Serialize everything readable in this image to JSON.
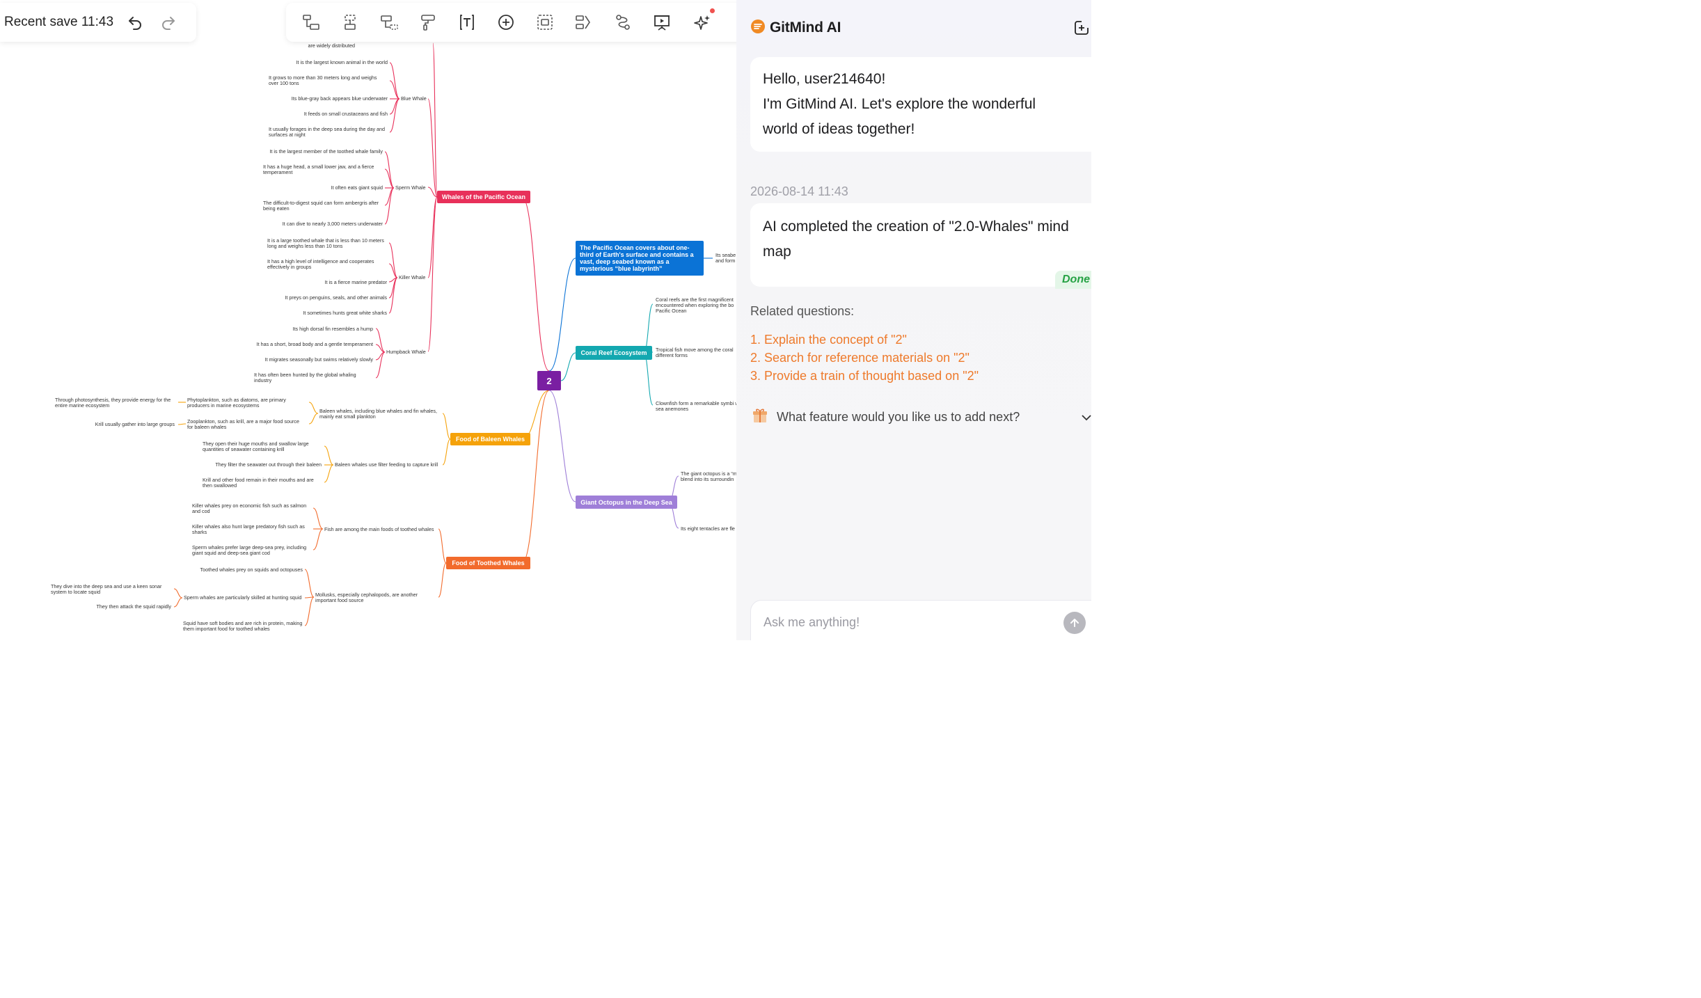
{
  "header": {
    "recent_save": "Recent save 11:43",
    "undo_icon": "undo-icon",
    "redo_icon": "redo-icon"
  },
  "toolbar": {
    "items": [
      "child-topic-icon",
      "sibling-topic-icon",
      "subtopic-icon",
      "format-painter-icon",
      "text-icon",
      "insert-icon",
      "boundary-icon",
      "summary-icon",
      "relationship-icon",
      "presentation-icon",
      "ai-sparkle-icon"
    ]
  },
  "mindmap": {
    "root": "2",
    "top_fragment": "are widely distributed",
    "whales": {
      "title": "Whales of the Pacific Ocean",
      "blue": {
        "label": "Blue Whale",
        "facts": [
          "It is the largest known animal in the world",
          "It grows to more than 30 meters long and weighs over 100 tons",
          "Its blue-gray back appears blue underwater",
          "It feeds on small crustaceans and fish",
          "It usually forages in the deep sea during the day and surfaces at night"
        ]
      },
      "sperm": {
        "label": "Sperm Whale",
        "facts": [
          "It is the largest member of the toothed whale family",
          "It has a huge head, a small lower jaw, and a fierce temperament",
          "It often eats giant squid",
          "The difficult-to-digest squid can form ambergris after being eaten",
          "It can dive to nearly 3,000 meters underwater"
        ]
      },
      "killer": {
        "label": "Killer Whale",
        "facts": [
          "It is a large toothed whale that is less than 10 meters long and weighs less than 10 tons",
          "It has a high level of intelligence and cooperates effectively in groups",
          "It is a fierce marine predator",
          "It preys on penguins, seals, and other animals",
          "It sometimes hunts great white sharks"
        ]
      },
      "humpback": {
        "label": "Humpback Whale",
        "facts": [
          "Its high dorsal fin resembles a hump",
          "It has a short, broad body and a gentle temperament",
          "It migrates seasonally but swims relatively slowly",
          "It has often been hunted by the global whaling industry"
        ]
      }
    },
    "baleen": {
      "title": "Food of Baleen Whales",
      "b1": "Baleen whales, including blue whales and fin whales, mainly eat small plankton",
      "phyto": "Phytoplankton, such as diatoms, are primary producers in marine ecosystems",
      "phyto_detail": "Through photosynthesis, they provide energy for the entire marine ecosystem",
      "zoo": "Zooplankton, such as krill, are a major food source for baleen whales",
      "zoo_detail": "Krill usually gather into large groups",
      "b2": "Baleen whales use filter feeding to capture krill",
      "b2_facts": [
        "They open their huge mouths and swallow large quantities of seawater containing krill",
        "They filter the seawater out through their baleen",
        "Krill and other food remain in their mouths and are then swallowed"
      ]
    },
    "toothed": {
      "title": "Food of Toothed Whales",
      "t1": "Fish are among the main foods of toothed whales",
      "t1_facts": [
        "Killer whales prey on economic fish such as salmon and cod",
        "Killer whales also hunt large predatory fish such as sharks",
        "Sperm whales prefer large deep-sea prey, including giant squid and deep-sea giant cod"
      ],
      "t2": "Mollusks, especially cephalopods, are another important food source",
      "t2_a": "Toothed whales prey on squids and octopuses",
      "t2_b": "Sperm whales are particularly skilled at hunting squid",
      "t2_b_facts": [
        "They dive into the deep sea and use a keen sonar system to locate squid",
        "They then attack the squid rapidly"
      ],
      "t2_c": "Squid have soft bodies and are rich in protein, making them important food for toothed whales"
    },
    "pacific": {
      "title": "The Pacific Ocean covers about one-third of Earth's surface and contains a vast, deep seabed known as a mysterious “blue labyrinth”",
      "child": "Its seabe and form"
    },
    "coral": {
      "title": "Coral Reef Ecosystem",
      "facts": [
        "Coral reefs are the first magnificent encountered when exploring the bo Pacific Ocean",
        "Tropical fish move among the coral different forms",
        "Clownfish form a remarkable symbi with sea anemones"
      ]
    },
    "octopus": {
      "title": "Giant Octopus in the Deep Sea",
      "facts": [
        "The giant octopus is a “m blend into its surroundin",
        "Its eight tentacles are fle"
      ]
    }
  },
  "ai_panel": {
    "brand": "GitMind AI",
    "greeting_1": "Hello, user214640!",
    "greeting_2": "I'm GitMind AI. Let's explore the wonderful",
    "greeting_3": "world of ideas together!",
    "timestamp": "2026-08-14 11:43",
    "message": "AI completed the creation of \"2.0-Whales\" mind map",
    "status": "Done",
    "related_title": "Related questions:",
    "questions": [
      "1. Explain the concept of \"2\"",
      "2. Search for reference materials on \"2\"",
      "3. Provide a train of thought based on \"2\""
    ],
    "feature_prompt": "What feature would you like us to add next?",
    "input_placeholder": "Ask me anything!"
  },
  "colors": {
    "root": "#7a1fa2",
    "whales": "#e8305a",
    "baleen": "#f5a20a",
    "toothed": "#f26b2c",
    "pacific": "#0b73d6",
    "coral": "#13a8b0",
    "octopus": "#9f7fd8",
    "ai_accent": "#ee7a2b",
    "done_green": "#25a244"
  }
}
